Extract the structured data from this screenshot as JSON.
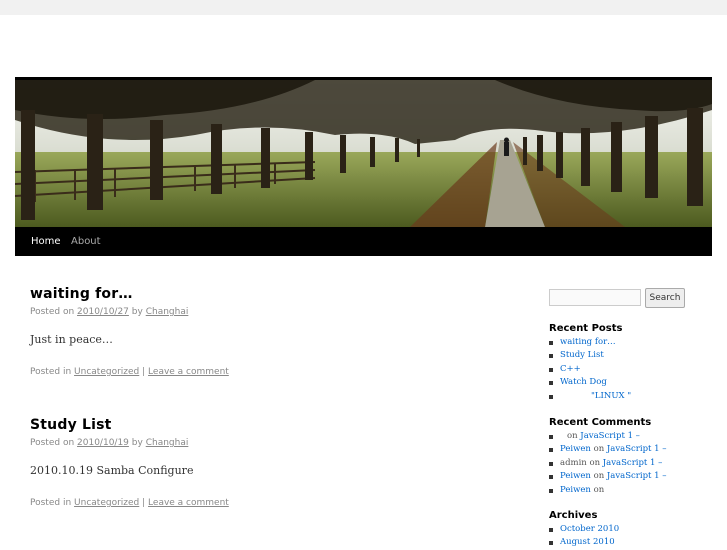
{
  "nav": {
    "items": [
      {
        "label": "Home",
        "active": true
      },
      {
        "label": "About",
        "active": false
      }
    ]
  },
  "posts": [
    {
      "title": "waiting for…",
      "posted_on": "Posted on",
      "date": "2010/10/27",
      "by": "by",
      "author": "Changhai",
      "content": "Just in peace…",
      "posted_in": "Posted in",
      "category": "Uncategorized",
      "separator": "|",
      "comment_link": "Leave a comment"
    },
    {
      "title": "Study List",
      "posted_on": "Posted on",
      "date": "2010/10/19",
      "by": "by",
      "author": "Changhai",
      "content": "2010.10.19 Samba Configure",
      "posted_in": "Posted in",
      "category": "Uncategorized",
      "separator": "|",
      "comment_link": "Leave a comment"
    }
  ],
  "sidebar": {
    "search_button": "Search",
    "recent_posts": {
      "title": "Recent Posts",
      "items": [
        "waiting for…",
        "Study List",
        "C++",
        "Watch Dog",
        "\"LINUX \""
      ]
    },
    "recent_comments": {
      "title": "Recent Comments",
      "items": [
        {
          "author": "",
          "on": "on",
          "post": "JavaScript 1 –"
        },
        {
          "author": "Peiwen",
          "on": "on",
          "post": "JavaScript 1 –"
        },
        {
          "author": "admin",
          "on": "on",
          "post": "JavaScript 1 –"
        },
        {
          "author": "Peiwen",
          "on": "on",
          "post": "JavaScript 1 –"
        },
        {
          "author": "Peiwen",
          "on": "on",
          "post": ""
        }
      ]
    },
    "archives": {
      "title": "Archives",
      "items": [
        "October 2010",
        "August 2010"
      ]
    }
  }
}
